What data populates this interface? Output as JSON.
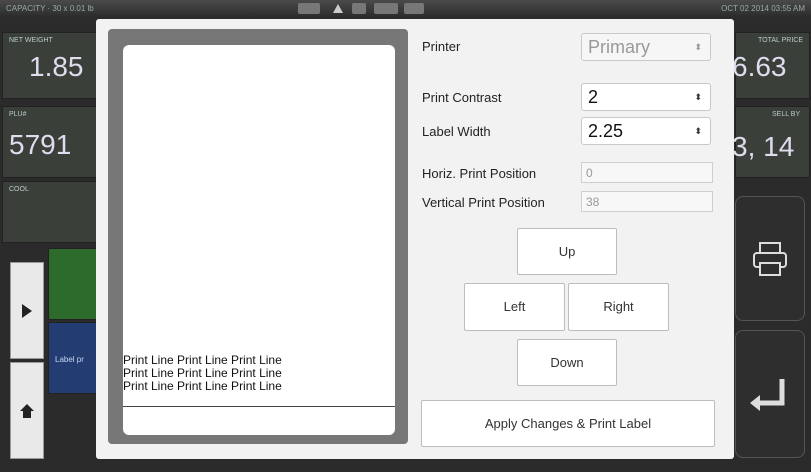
{
  "statusbar": {
    "capacity": "CAPACITY · 30 x 0.01 lb",
    "datetime": "OCT 02 2014 03:55 AM"
  },
  "background": {
    "net_weight": {
      "title": "NET WEIGHT",
      "value": "1.85"
    },
    "plu": {
      "title": "PLU#",
      "value": "5791"
    },
    "cool": {
      "title": "COOL"
    },
    "total_price": {
      "title": "TOTAL PRICE",
      "value": "6.63"
    },
    "sell_by": {
      "title": "SELL BY",
      "value": "3, 14"
    },
    "label_preview_tab": "Label pr"
  },
  "dialog": {
    "preview_lines": [
      "Print Line Print Line Print Line",
      "Print Line Print Line Print Line",
      "Print Line Print Line Print Line"
    ],
    "printer": {
      "label": "Printer",
      "value": "Primary"
    },
    "contrast": {
      "label": "Print Contrast",
      "value": "2"
    },
    "label_width": {
      "label": "Label Width",
      "value": "2.25"
    },
    "horiz_position": {
      "label": "Horiz. Print Position",
      "value": "0"
    },
    "vertical_position": {
      "label": "Vertical Print Position",
      "value": "38"
    },
    "buttons": {
      "up": "Up",
      "left": "Left",
      "right": "Right",
      "down": "Down",
      "apply": "Apply Changes & Print Label"
    },
    "select_arrow": "⬍"
  },
  "icons": {
    "printer": "printer-icon",
    "enter": "enter-icon",
    "home": "home-icon",
    "expand": "expand-arrow-icon"
  }
}
